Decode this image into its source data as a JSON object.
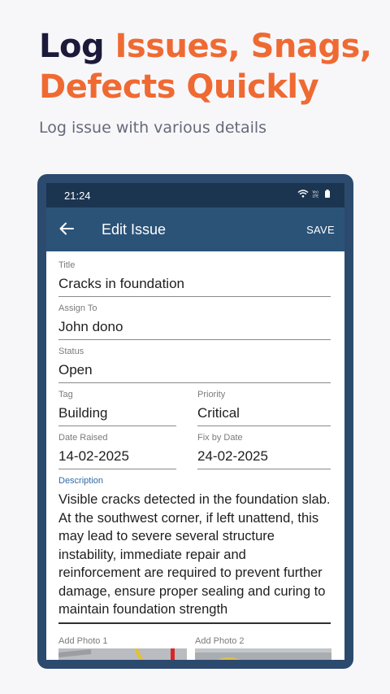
{
  "hero": {
    "title_dark": "Log",
    "title_accent_1": "Issues, Snags,",
    "title_accent_2": "Defects Quickly",
    "subtitle": "Log issue with various details"
  },
  "statusbar": {
    "time": "21:24",
    "icons": [
      "wifi-icon",
      "volte-lte-icon",
      "battery-icon"
    ]
  },
  "appbar": {
    "title": "Edit Issue",
    "save_label": "SAVE"
  },
  "form": {
    "title": {
      "label": "Title",
      "value": "Cracks in foundation"
    },
    "assign_to": {
      "label": "Assign To",
      "value": "John dono"
    },
    "status": {
      "label": "Status",
      "value": "Open"
    },
    "tag": {
      "label": "Tag",
      "value": "Building"
    },
    "priority": {
      "label": "Priority",
      "value": "Critical"
    },
    "date_raised": {
      "label": "Date Raised",
      "value": "14-02-2025"
    },
    "fix_by_date": {
      "label": "Fix by Date",
      "value": "24-02-2025"
    },
    "description": {
      "label": "Description",
      "value": "Visible cracks detected in the foundation slab. At the southwest corner, if left unattend, this may lead to severe several structure instability, immediate repair and reinforcement are required to prevent further damage, ensure proper sealing and curing to maintain foundation strength"
    },
    "photos": [
      {
        "label": "Add Photo 1"
      },
      {
        "label": "Add Photo 2"
      }
    ]
  },
  "colors": {
    "accent": "#ef6a32",
    "title_dark": "#1b1a3a",
    "device_frame": "#2c4a6d",
    "appbar": "#2b5378",
    "statusbar": "#1b3550",
    "focus_label": "#2f6aa5"
  }
}
